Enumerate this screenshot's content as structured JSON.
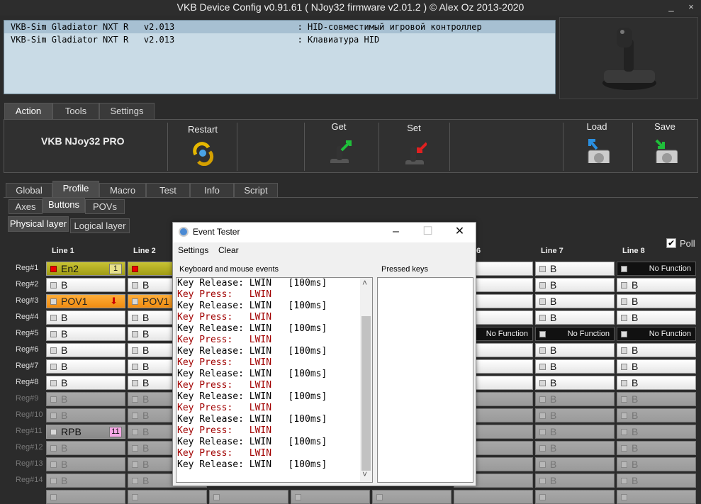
{
  "window": {
    "title": "VKB Device Config v0.91.61 ( NJoy32 firmware v2.01.2 ) © Alex Oz 2013-2020",
    "minimize": "_",
    "close": "×"
  },
  "devices": [
    {
      "text": "VKB-Sim Gladiator NXT R   v2.013                        : HID-совместимый игровой контроллер"
    },
    {
      "text": "VKB-Sim Gladiator NXT R   v2.013                        : Клавиатура HID"
    }
  ],
  "main_tabs": [
    {
      "label": "Action"
    },
    {
      "label": "Tools"
    },
    {
      "label": "Settings"
    }
  ],
  "action_panel": {
    "device_name": "VKB NJoy32 PRO",
    "buttons": [
      {
        "label": "Restart",
        "icon": "restart-icon"
      },
      {
        "label": "Get",
        "icon": "get-joystick-icon"
      },
      {
        "label": "Set",
        "icon": "set-joystick-icon"
      },
      {
        "label": "Load",
        "icon": "load-disk-icon"
      },
      {
        "label": "Save",
        "icon": "save-disk-icon"
      }
    ]
  },
  "section_tabs": [
    {
      "label": "Global"
    },
    {
      "label": "Profile"
    },
    {
      "label": "Macro"
    },
    {
      "label": "Test"
    },
    {
      "label": "Info"
    },
    {
      "label": "Script"
    }
  ],
  "profile_tabs": [
    {
      "label": "Axes"
    },
    {
      "label": "Buttons"
    },
    {
      "label": "POVs"
    }
  ],
  "layer_tabs": [
    {
      "label": "Physical layer"
    },
    {
      "label": "Logical layer"
    }
  ],
  "poll": {
    "label": "Poll",
    "checked": true,
    "mark": "✔"
  },
  "columns": [
    {
      "label": "Line 1"
    },
    {
      "label": "Line 2"
    },
    {
      "label": "6"
    },
    {
      "label": "Line 7"
    },
    {
      "label": "Line 8"
    }
  ],
  "rows": [
    {
      "label": "Reg#1"
    },
    {
      "label": "Reg#2"
    },
    {
      "label": "Reg#3"
    },
    {
      "label": "Reg#4"
    },
    {
      "label": "Reg#5"
    },
    {
      "label": "Reg#6"
    },
    {
      "label": "Reg#7"
    },
    {
      "label": "Reg#8"
    },
    {
      "label": "Reg#9"
    },
    {
      "label": "Reg#10"
    },
    {
      "label": "Reg#11"
    },
    {
      "label": "Reg#12"
    },
    {
      "label": "Reg#13"
    },
    {
      "label": "Reg#14"
    }
  ],
  "cells": {
    "b": "B",
    "en2": "En2",
    "en2_badge": "1",
    "pov1": "POV1",
    "rpb": "RPB",
    "rpb_badge": "11",
    "no_function": "No Function"
  },
  "dialog": {
    "title": "Event Tester",
    "menu": [
      {
        "label": "Settings"
      },
      {
        "label": "Clear"
      }
    ],
    "events_label": "Keyboard and mouse events",
    "pressed_label": "Pressed keys",
    "scroll_up": "˄",
    "scroll_down": "˅",
    "events": [
      {
        "text": "Key Release: LWIN   [100ms]",
        "kind": "release"
      },
      {
        "text": "Key Press:   LWIN",
        "kind": "press"
      },
      {
        "text": "Key Release: LWIN   [100ms]",
        "kind": "release"
      },
      {
        "text": "Key Press:   LWIN",
        "kind": "press"
      },
      {
        "text": "Key Release: LWIN   [100ms]",
        "kind": "release"
      },
      {
        "text": "Key Press:   LWIN",
        "kind": "press"
      },
      {
        "text": "Key Release: LWIN   [100ms]",
        "kind": "release"
      },
      {
        "text": "Key Press:   LWIN",
        "kind": "press"
      },
      {
        "text": "Key Release: LWIN   [100ms]",
        "kind": "release"
      },
      {
        "text": "Key Press:   LWIN",
        "kind": "press"
      },
      {
        "text": "Key Release: LWIN   [100ms]",
        "kind": "release"
      },
      {
        "text": "Key Press:   LWIN",
        "kind": "press"
      },
      {
        "text": "Key Release: LWIN   [100ms]",
        "kind": "release"
      },
      {
        "text": "Key Press:   LWIN",
        "kind": "press"
      },
      {
        "text": "Key Release: LWIN   [100ms]",
        "kind": "release"
      },
      {
        "text": "Key Press:   LWIN",
        "kind": "press"
      },
      {
        "text": "Key Release: LWIN   [100ms]",
        "kind": "release"
      }
    ]
  },
  "colors": {
    "accent_olive": "#b5b024",
    "accent_orange": "#f59a1e",
    "badge_pink": "#f7a8e6",
    "press_red": "#a10000"
  }
}
